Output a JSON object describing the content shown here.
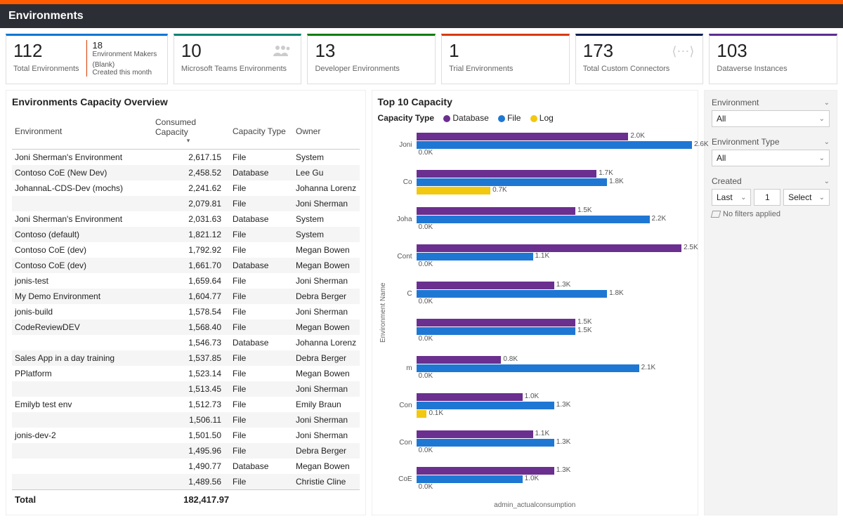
{
  "header": {
    "title": "Environments"
  },
  "cards": {
    "total_env": {
      "value": "112",
      "label": "Total Environments",
      "sub_value": "18",
      "sub_label1": "Environment Makers",
      "sub_label2": "(Blank)",
      "sub_label3": "Created this month"
    },
    "teams": {
      "value": "10",
      "label": "Microsoft Teams Environments"
    },
    "developer": {
      "value": "13",
      "label": "Developer Environments"
    },
    "trial": {
      "value": "1",
      "label": "Trial Environments"
    },
    "connectors": {
      "value": "173",
      "label": "Total Custom Connectors"
    },
    "dataverse": {
      "value": "103",
      "label": "Dataverse Instances"
    }
  },
  "capacity_table": {
    "title": "Environments Capacity Overview",
    "columns": {
      "env": "Environment",
      "consumed": "Consumed Capacity",
      "type": "Capacity Type",
      "owner": "Owner"
    },
    "rows": [
      {
        "env": "Joni Sherman's Environment",
        "consumed": "2,617.15",
        "type": "File",
        "owner": "System"
      },
      {
        "env": "Contoso CoE (New Dev)",
        "consumed": "2,458.52",
        "type": "Database",
        "owner": "Lee Gu"
      },
      {
        "env": "JohannaL-CDS-Dev (mochs)",
        "consumed": "2,241.62",
        "type": "File",
        "owner": "Johanna Lorenz"
      },
      {
        "env": "",
        "consumed": "2,079.81",
        "type": "File",
        "owner": "Joni Sherman"
      },
      {
        "env": "Joni Sherman's Environment",
        "consumed": "2,031.63",
        "type": "Database",
        "owner": "System"
      },
      {
        "env": "Contoso (default)",
        "consumed": "1,821.12",
        "type": "File",
        "owner": "System"
      },
      {
        "env": "Contoso CoE (dev)",
        "consumed": "1,792.92",
        "type": "File",
        "owner": "Megan Bowen"
      },
      {
        "env": "Contoso CoE (dev)",
        "consumed": "1,661.70",
        "type": "Database",
        "owner": "Megan Bowen"
      },
      {
        "env": "jonis-test",
        "consumed": "1,659.64",
        "type": "File",
        "owner": "Joni Sherman"
      },
      {
        "env": "My Demo Environment",
        "consumed": "1,604.77",
        "type": "File",
        "owner": "Debra Berger"
      },
      {
        "env": "jonis-build",
        "consumed": "1,578.54",
        "type": "File",
        "owner": "Joni Sherman"
      },
      {
        "env": "CodeReviewDEV",
        "consumed": "1,568.40",
        "type": "File",
        "owner": "Megan Bowen"
      },
      {
        "env": "",
        "consumed": "1,546.73",
        "type": "Database",
        "owner": "Johanna Lorenz"
      },
      {
        "env": "Sales App in a day training",
        "consumed": "1,537.85",
        "type": "File",
        "owner": "Debra Berger"
      },
      {
        "env": "PPlatform",
        "consumed": "1,523.14",
        "type": "File",
        "owner": "Megan Bowen"
      },
      {
        "env": "",
        "consumed": "1,513.45",
        "type": "File",
        "owner": "Joni Sherman"
      },
      {
        "env": "Emilyb test env",
        "consumed": "1,512.73",
        "type": "File",
        "owner": "Emily Braun"
      },
      {
        "env": "",
        "consumed": "1,506.11",
        "type": "File",
        "owner": "Joni Sherman"
      },
      {
        "env": "jonis-dev-2",
        "consumed": "1,501.50",
        "type": "File",
        "owner": "Joni Sherman"
      },
      {
        "env": "",
        "consumed": "1,495.96",
        "type": "File",
        "owner": "Debra Berger"
      },
      {
        "env": "",
        "consumed": "1,490.77",
        "type": "Database",
        "owner": "Megan Bowen"
      },
      {
        "env": "",
        "consumed": "1,489.56",
        "type": "File",
        "owner": "Christie Cline"
      }
    ],
    "total_label": "Total",
    "total_value": "182,417.97"
  },
  "chart_data": {
    "type": "bar",
    "title": "Top 10 Capacity",
    "legend_label": "Capacity Type",
    "ylabel": "Environment Name",
    "xlabel": "admin_actualconsumption",
    "xlim": [
      0,
      2.6
    ],
    "series_names": {
      "db": "Database",
      "fl": "File",
      "lg": "Log"
    },
    "categories": [
      "Joni",
      "Co",
      "Joha",
      "Cont",
      "C",
      "",
      "m",
      "Con",
      "Con",
      "CoE"
    ],
    "series": [
      {
        "name": "Database",
        "key": "db",
        "values": [
          2.0,
          1.7,
          1.5,
          2.5,
          1.3,
          1.5,
          0.8,
          1.0,
          1.1,
          1.3
        ],
        "labels": [
          "2.0K",
          "1.7K",
          "1.5K",
          "2.5K",
          "1.3K",
          "1.5K",
          "0.8K",
          "1.0K",
          "1.1K",
          "1.3K"
        ]
      },
      {
        "name": "File",
        "key": "fl",
        "values": [
          2.6,
          1.8,
          2.2,
          1.1,
          1.8,
          1.5,
          2.1,
          1.3,
          1.3,
          1.0
        ],
        "labels": [
          "2.6K",
          "1.8K",
          "2.2K",
          "1.1K",
          "1.8K",
          "1.5K",
          "2.1K",
          "1.3K",
          "1.3K",
          "1.0K"
        ]
      },
      {
        "name": "Log",
        "key": "lg",
        "values": [
          0.0,
          0.7,
          0.0,
          0.0,
          0.0,
          0.0,
          0.0,
          0.1,
          0.0,
          0.0
        ],
        "labels": [
          "0.0K",
          "0.7K",
          "0.0K",
          "0.0K",
          "0.0K",
          "0.0K",
          "0.0K",
          "0.1K",
          "0.0K",
          "0.0K"
        ]
      }
    ]
  },
  "filters": {
    "environment": {
      "label": "Environment",
      "value": "All"
    },
    "environment_type": {
      "label": "Environment Type",
      "value": "All"
    },
    "created": {
      "label": "Created",
      "mode": "Last",
      "count": "1",
      "unit": "Select",
      "none": "No filters applied"
    }
  }
}
